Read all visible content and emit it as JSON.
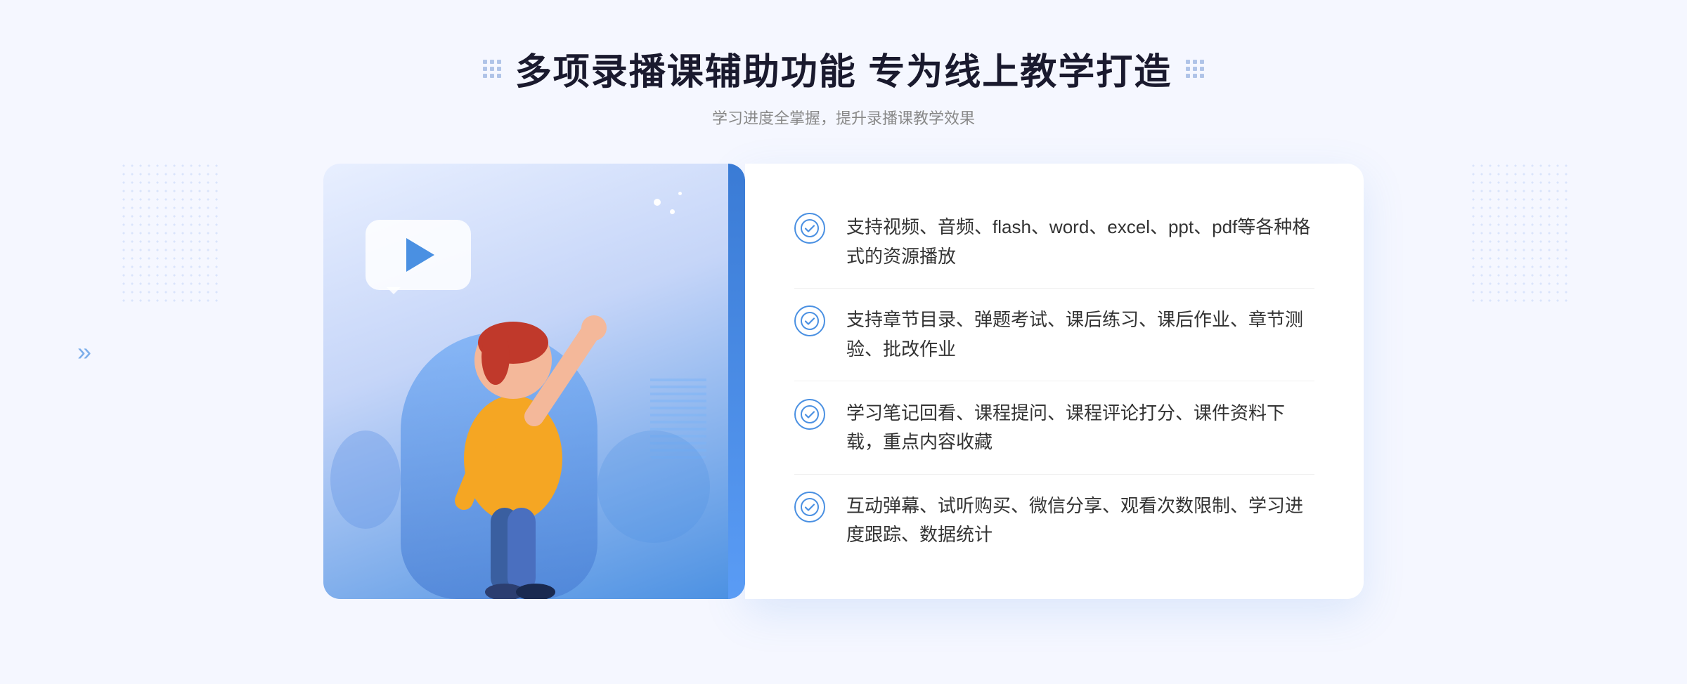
{
  "header": {
    "title": "多项录播课辅助功能 专为线上教学打造",
    "subtitle": "学习进度全掌握，提升录播课教学效果"
  },
  "features": [
    {
      "id": "feature-1",
      "text": "支持视频、音频、flash、word、excel、ppt、pdf等各种格式的资源播放"
    },
    {
      "id": "feature-2",
      "text": "支持章节目录、弹题考试、课后练习、课后作业、章节测验、批改作业"
    },
    {
      "id": "feature-3",
      "text": "学习笔记回看、课程提问、课程评论打分、课件资料下载，重点内容收藏"
    },
    {
      "id": "feature-4",
      "text": "互动弹幕、试听购买、微信分享、观看次数限制、学习进度跟踪、数据统计"
    }
  ],
  "decoration": {
    "chevron_left": "»",
    "chevron_right": "»",
    "check_symbol": "✓"
  }
}
